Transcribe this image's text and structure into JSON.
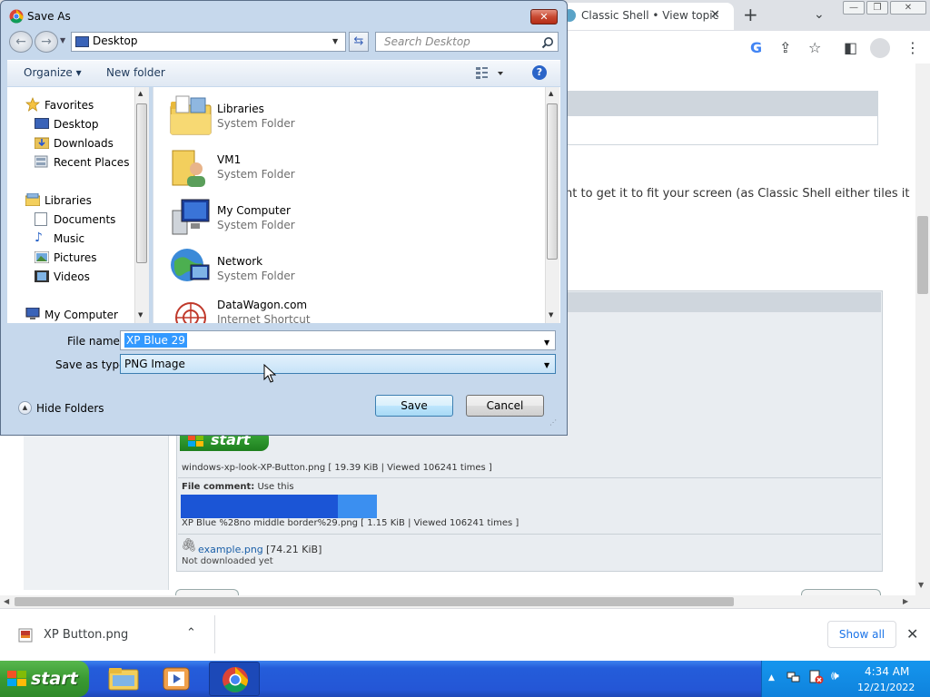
{
  "browser": {
    "tab_title": "Classic Shell • View topic",
    "tab_close": "✕",
    "new_tab": "+",
    "tab_list": "⌄",
    "page_text": "nt to get it to fit your screen (as Classic Shell either tiles it",
    "attachment1_name": "windows-xp-look-XP-Button.png [ 19.39 KiB | Viewed 106241 times ]",
    "file_comment_label": "File comment:",
    "file_comment_text": " Use this",
    "attachment2_name": "XP Blue %28no middle border%29.png [ 1.15 KiB | Viewed 106241 times ]",
    "example_link": "example.png",
    "example_size": "[74.21 KiB]",
    "example_note": "Not downloaded yet",
    "xp_start_label": "start"
  },
  "download_bar": {
    "file_name": "XP Button.png",
    "show_all": "Show all",
    "close": "✕"
  },
  "taskbar": {
    "start_label": "start",
    "time": "4:34 AM",
    "date": "12/21/2022"
  },
  "dialog": {
    "title": "Save As",
    "address": "Desktop",
    "search_placeholder": "Search Desktop",
    "organize": "Organize ▾",
    "new_folder": "New folder",
    "help": "?",
    "nav": {
      "favorites": "Favorites",
      "desktop": "Desktop",
      "downloads": "Downloads",
      "recent": "Recent Places",
      "libraries": "Libraries",
      "documents": "Documents",
      "music": "Music",
      "pictures": "Pictures",
      "videos": "Videos",
      "computer": "My Computer"
    },
    "items": [
      {
        "name": "Libraries",
        "type": "System Folder"
      },
      {
        "name": "VM1",
        "type": "System Folder"
      },
      {
        "name": "My Computer",
        "type": "System Folder"
      },
      {
        "name": "Network",
        "type": "System Folder"
      },
      {
        "name": "DataWagon.com",
        "type": "Internet Shortcut"
      }
    ],
    "file_name_label": "File name:",
    "file_name_value": "XP Blue 29",
    "save_type_label": "Save as type:",
    "save_type_value": "PNG Image",
    "hide_folders": "Hide Folders",
    "save": "Save",
    "cancel": "Cancel"
  },
  "colors": {
    "dialog_frame": "#c6d8ec",
    "taskbar": "#245dda",
    "start_green": "#3a9a32",
    "selection": "#3399ff",
    "link": "#1a5fa8"
  }
}
